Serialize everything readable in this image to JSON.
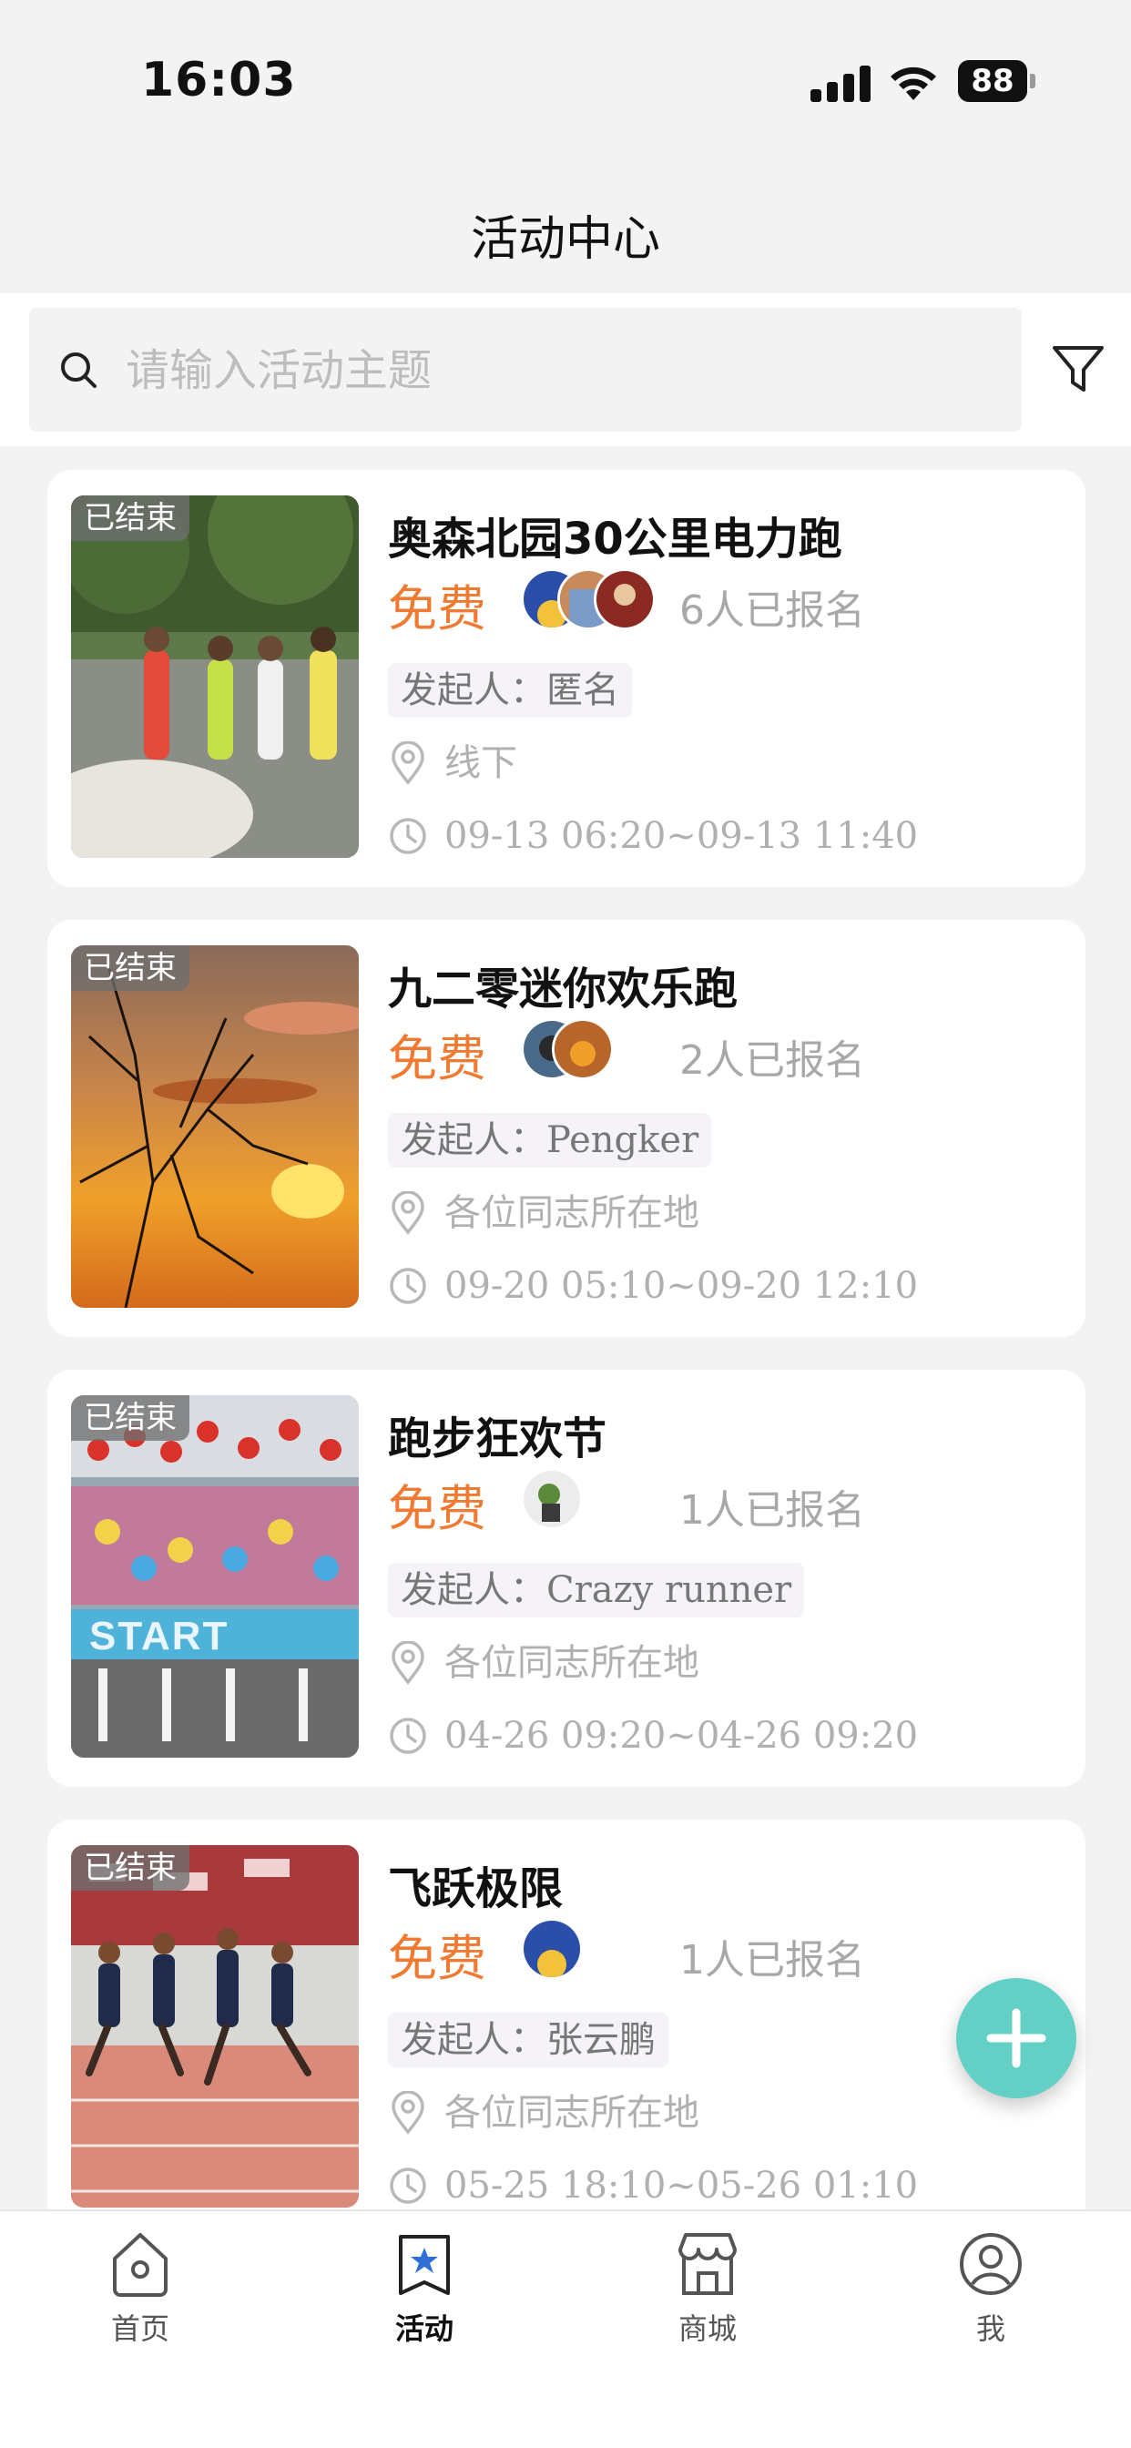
{
  "status_bar": {
    "time": "16:03",
    "battery": "88"
  },
  "header": {
    "title": "活动中心"
  },
  "search": {
    "placeholder": "请输入活动主题"
  },
  "activities": [
    {
      "badge": "已结束",
      "title": "奥森北园30公里电力跑",
      "price": "免费",
      "signup": "6人已报名",
      "organizer": "发起人：匿名",
      "location": "线下",
      "time": "09-13 06:20~09-13 11:40"
    },
    {
      "badge": "已结束",
      "title": "九二零迷你欢乐跑",
      "price": "免费",
      "signup": "2人已报名",
      "organizer": "发起人：Pengker",
      "location": "各位同志所在地",
      "time": "09-20 05:10~09-20 12:10"
    },
    {
      "badge": "已结束",
      "title": "跑步狂欢节",
      "price": "免费",
      "signup": "1人已报名",
      "organizer": "发起人：Crazy runner",
      "location": "各位同志所在地",
      "time": "04-26 09:20~04-26 09:20",
      "thumb_text": "START"
    },
    {
      "badge": "已结束",
      "title": "飞跃极限",
      "price": "免费",
      "signup": "1人已报名",
      "organizer": "发起人：张云鹏",
      "location": "各位同志所在地",
      "time": "05-25 18:10~05-26 01:10"
    }
  ],
  "fab": {
    "icon": "plus-icon",
    "color": "#63d0c5"
  },
  "tabs": [
    {
      "label": "首页",
      "icon": "home-icon"
    },
    {
      "label": "活动",
      "icon": "activity-icon",
      "active": true
    },
    {
      "label": "商城",
      "icon": "store-icon"
    },
    {
      "label": "我",
      "icon": "profile-icon"
    }
  ],
  "colors": {
    "price": "#f07a32",
    "accent": "#63d0c5",
    "muted": "#b0b0b0"
  }
}
